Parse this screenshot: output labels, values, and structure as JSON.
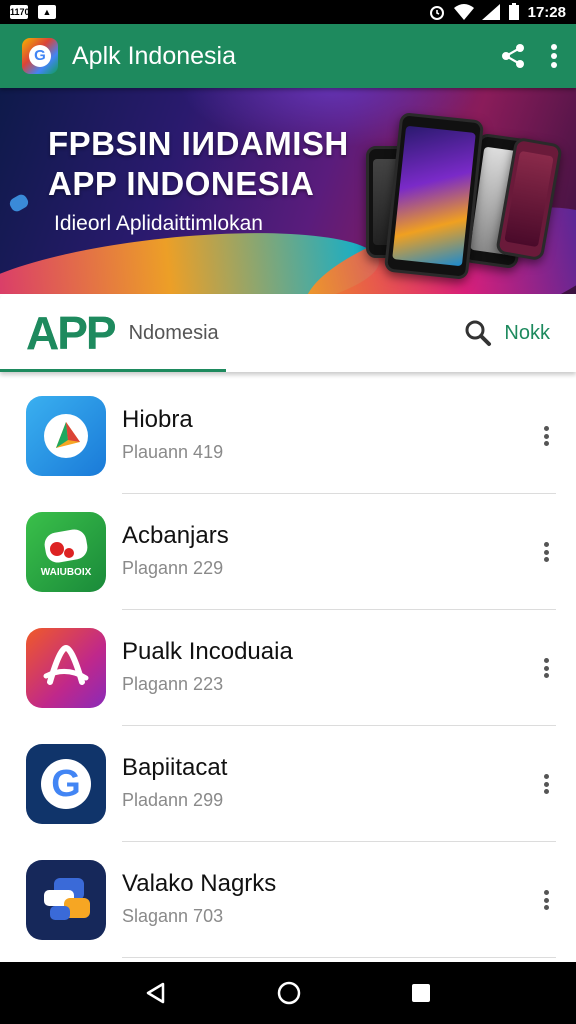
{
  "status_bar": {
    "left_badge": "1170",
    "time": "17:28"
  },
  "app_bar": {
    "title": "Aplk Indonesia",
    "logo_letter": "G"
  },
  "banner": {
    "title_line1": "FPBSIN IИDAMISH",
    "title_line2": "APP INDONESIA",
    "subtitle": "Idieorl Aplidaittimlokan"
  },
  "tab_bar": {
    "logo_text": "APP",
    "label": "Ndomesia",
    "search_label": "Nokk"
  },
  "list": {
    "items": [
      {
        "title": "Hiobra",
        "subtitle": "Plauann 419",
        "icon": "paper-plane-icon"
      },
      {
        "title": "Acbanjars",
        "subtitle": "Plagann 229",
        "icon": "game-controller-icon",
        "icon_text": "WAIUBOIX"
      },
      {
        "title": "Pualk Incoduaia",
        "subtitle": "Plagann 223",
        "icon": "swirl-a-icon"
      },
      {
        "title": "Bapiitacat",
        "subtitle": "Pladann 299",
        "icon": "g-logo-icon",
        "icon_text": "G"
      },
      {
        "title": "Valako Nagrks",
        "subtitle": "Slagann 703",
        "icon": "chat-blocks-icon"
      }
    ]
  },
  "colors": {
    "primary": "#1e8a5e",
    "status_bar": "#000000",
    "nav_bar": "#000000"
  }
}
